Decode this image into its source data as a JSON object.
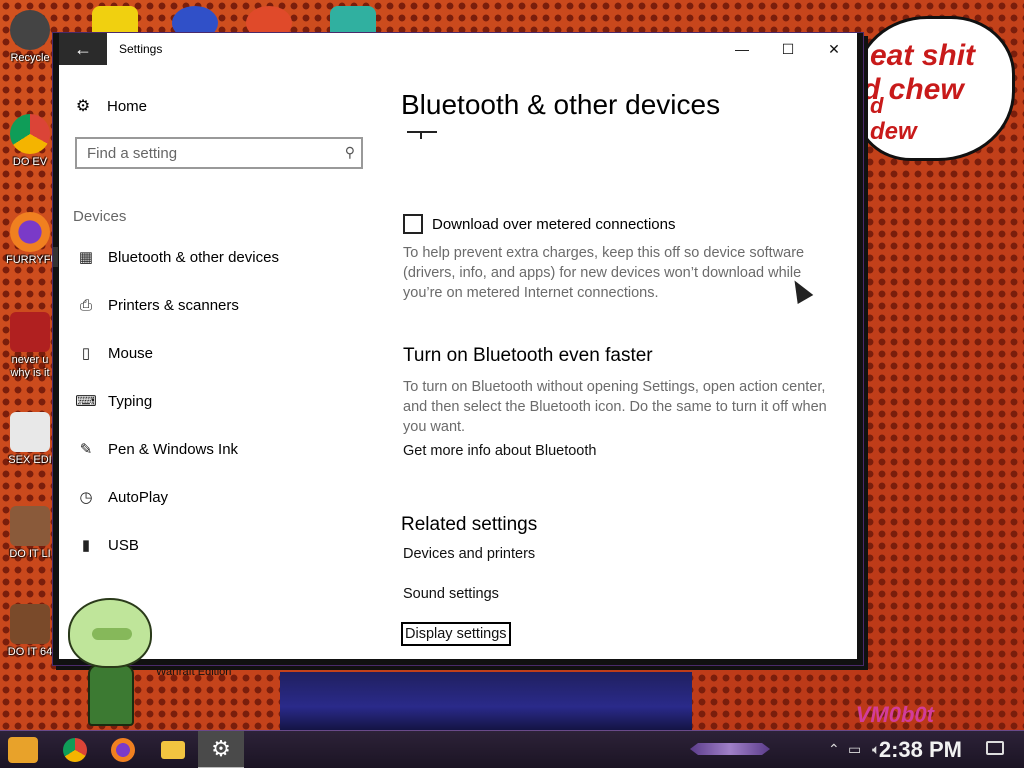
{
  "desktop": {
    "icons": [
      {
        "label": "Recycle"
      },
      {
        "label": "DO EV"
      },
      {
        "label": "FURRYFU"
      },
      {
        "label": "never u why is it"
      },
      {
        "label": "SEX EDI"
      },
      {
        "label": "DO IT LI"
      },
      {
        "label": "DO IT 64"
      }
    ],
    "bubble_lines": [
      "eat shit",
      "d chew",
      "d",
      "dew"
    ],
    "bottom_caption": "Warfraft Edition",
    "corner_tag": "VM0b0t"
  },
  "window": {
    "title": "Settings",
    "back_glyph": "←",
    "minimize_glyph": "—",
    "maximize_glyph": "☐",
    "close_glyph": "✕"
  },
  "nav": {
    "home_label": "Home",
    "search_placeholder": "Find a setting",
    "section_label": "Devices",
    "items": [
      {
        "label": "Bluetooth & other devices",
        "icon": "bluetooth-devices-icon",
        "glyph": "▦"
      },
      {
        "label": "Printers & scanners",
        "icon": "printer-icon",
        "glyph": "⎙"
      },
      {
        "label": "Mouse",
        "icon": "mouse-icon",
        "glyph": "▯"
      },
      {
        "label": "Typing",
        "icon": "keyboard-icon",
        "glyph": "⌨"
      },
      {
        "label": "Pen & Windows Ink",
        "icon": "pen-icon",
        "glyph": "✎"
      },
      {
        "label": "AutoPlay",
        "icon": "autoplay-icon",
        "glyph": "◷"
      },
      {
        "label": "USB",
        "icon": "usb-icon",
        "glyph": "▮"
      }
    ]
  },
  "content": {
    "page_title": "Bluetooth & other devices",
    "metered_checkbox_label": "Download over metered connections",
    "metered_checked": false,
    "metered_description": "To help prevent extra charges, keep this off so device software (drivers, info, and apps) for new devices won’t download while you’re on metered Internet connections.",
    "faster_heading": "Turn on Bluetooth even faster",
    "faster_description": "To turn on Bluetooth without opening Settings, open action center, and then select the Bluetooth icon. Do the same to turn it off when you want.",
    "more_info_link": "Get more info about Bluetooth",
    "related_heading": "Related settings",
    "related_links": [
      "Devices and printers",
      "Sound settings",
      "Display settings"
    ]
  },
  "taskbar": {
    "clock": "2:38 PM",
    "accent": "#6a4a8a"
  }
}
